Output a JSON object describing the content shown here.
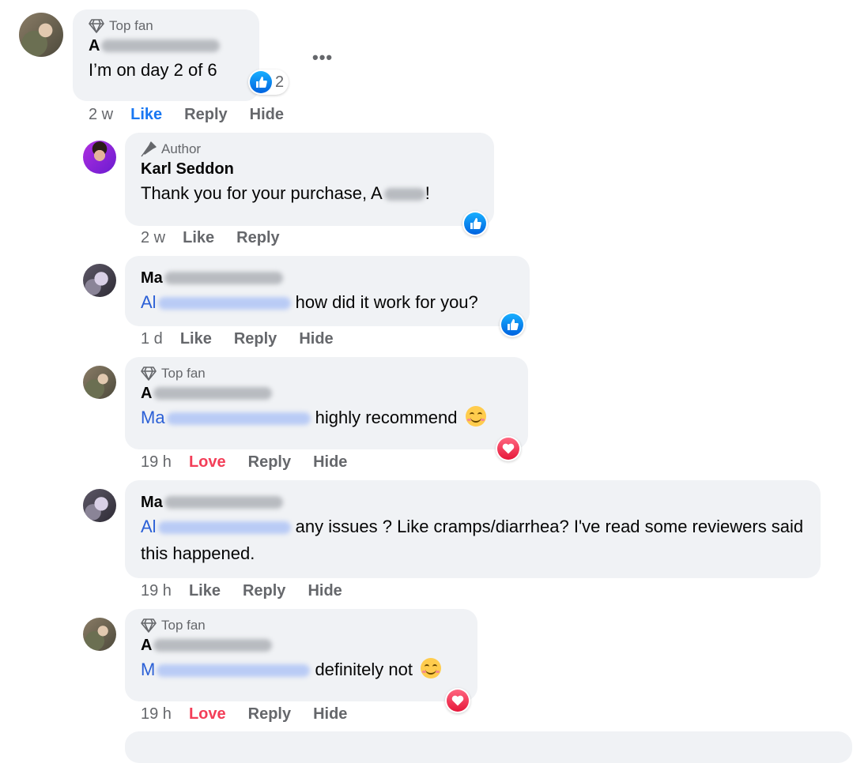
{
  "comments": [
    {
      "badge": "Top fan",
      "author_visible": "A",
      "text": "I’m on day 2 of 6",
      "reaction_count": "2",
      "time": "2 w",
      "actions": [
        "Like",
        "Reply",
        "Hide"
      ],
      "more_label": "•••"
    },
    {
      "badge": "Author",
      "author": "Karl Seddon",
      "text_before": "Thank you for your purchase, A",
      "text_after": "!",
      "time": "2 w",
      "actions": [
        "Like",
        "Reply"
      ]
    },
    {
      "author_visible": "Ma",
      "mention_visible": "Al",
      "text": " how did it work for you?",
      "time": "1 d",
      "actions": [
        "Like",
        "Reply",
        "Hide"
      ]
    },
    {
      "badge": "Top fan",
      "author_visible": "A",
      "mention_visible": "Ma",
      "text": " highly recommend",
      "time": "19 h",
      "actions": [
        "Love",
        "Reply",
        "Hide"
      ]
    },
    {
      "author_visible": "Ma",
      "mention_visible": "Al",
      "text": " any issues ? Like cramps/diarrhea? I've read some reviewers said this happened.",
      "time": "19 h",
      "actions": [
        "Like",
        "Reply",
        "Hide"
      ]
    },
    {
      "badge": "Top fan",
      "author_visible": "A",
      "mention_visible": "M",
      "text": " definitely not",
      "time": "19 h",
      "actions": [
        "Love",
        "Reply",
        "Hide"
      ]
    }
  ],
  "colors": {
    "bubble": "#f0f2f5",
    "like": "#1877f2",
    "love": "#f33e58",
    "muted": "#65676b"
  },
  "icons": {
    "badge_top_fan": "diamond-icon",
    "badge_author": "microphone-icon",
    "like": "thumbs-up-icon",
    "love": "heart-icon",
    "emoji": "smiling-face-icon"
  }
}
